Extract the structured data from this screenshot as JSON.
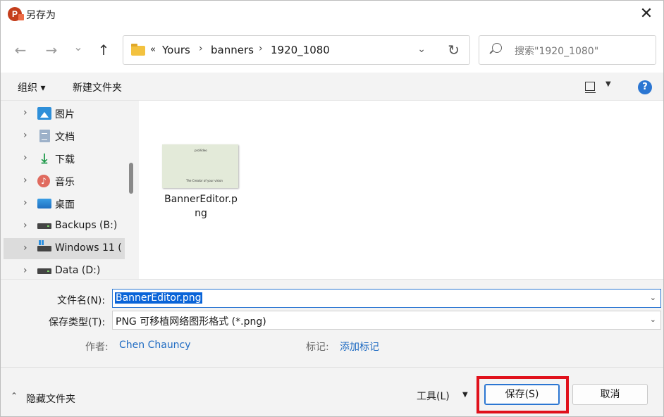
{
  "window": {
    "title": "另存为",
    "app_icon_letter": "P",
    "close_glyph": "✕"
  },
  "nav": {
    "back_glyph": "←",
    "forward_glyph": "→",
    "recent_glyph": "⌄",
    "up_glyph": "↑",
    "address": {
      "overflow_glyph": "«",
      "separator": "›",
      "crumbs": [
        "Yours",
        "banners",
        "1920_1080"
      ],
      "dropdown_glyph": "⌄",
      "refresh_glyph": "↻"
    },
    "search_placeholder": "搜索\"1920_1080\""
  },
  "toolbar": {
    "organize": "组织 ▾",
    "new_folder": "新建文件夹",
    "view_drop": "▼",
    "help": "?"
  },
  "sidebar": {
    "chevron": "›",
    "items": [
      {
        "label": "图片",
        "icon": "pictures-icon"
      },
      {
        "label": "文档",
        "icon": "documents-icon"
      },
      {
        "label": "下载",
        "icon": "downloads-icon"
      },
      {
        "label": "音乐",
        "icon": "music-icon"
      },
      {
        "label": "桌面",
        "icon": "desktop-icon"
      },
      {
        "label": "Backups (B:)",
        "icon": "drive-icon"
      },
      {
        "label": "Windows 11 (",
        "icon": "windows-drive-icon",
        "selected": true
      },
      {
        "label": "Data (D:)",
        "icon": "drive-icon"
      }
    ]
  },
  "content": {
    "files": [
      {
        "name": "BannerEditor.png",
        "thumb_line1": "proVideo",
        "thumb_line2": "The Creator of your vision"
      }
    ]
  },
  "form": {
    "filename_label": "文件名(N):",
    "filename_value": "BannerEditor.png",
    "filetype_label": "保存类型(T):",
    "filetype_value": "PNG 可移植网络图形格式 (*.png)",
    "dropdown_glyph": "⌄",
    "author_label": "作者:",
    "author_value": "Chen Chauncy",
    "tags_label": "标记:",
    "tags_value": "添加标记"
  },
  "footer": {
    "hide_chev": "⌃",
    "hide_folders": "隐藏文件夹",
    "tools": "工具(L)",
    "tools_drop": "▼",
    "save": "保存(S)",
    "cancel": "取消"
  },
  "colors": {
    "accent": "#2b76d2",
    "highlight": "#e0111b",
    "selection": "#0a64d8"
  }
}
